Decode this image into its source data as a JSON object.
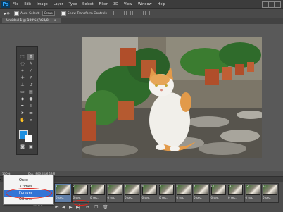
{
  "app": {
    "logo": "Ps"
  },
  "menubar": {
    "items": [
      "File",
      "Edit",
      "Image",
      "Layer",
      "Type",
      "Select",
      "Filter",
      "3D",
      "View",
      "Window",
      "Help"
    ]
  },
  "options": {
    "auto_select_label": "Auto-Select:",
    "auto_select_value": "Group",
    "transform_label": "Show Transform Controls"
  },
  "document": {
    "tab_title": "Untitled-1 @ 100% (RGB/8)"
  },
  "status": {
    "zoom": "100%",
    "doc_info": "Doc: 806.4K/6.13M"
  },
  "timeline": {
    "frames": [
      {
        "num": "1",
        "delay": "0 sec.",
        "selected": true
      },
      {
        "num": "2",
        "delay": "0 sec."
      },
      {
        "num": "3",
        "delay": "0 sec."
      },
      {
        "num": "4",
        "delay": "0 sec."
      },
      {
        "num": "5",
        "delay": "0 sec."
      },
      {
        "num": "6",
        "delay": "0 sec."
      },
      {
        "num": "7",
        "delay": "0 sec."
      },
      {
        "num": "8",
        "delay": "0 sec."
      },
      {
        "num": "9",
        "delay": "0 sec."
      },
      {
        "num": "10",
        "delay": "0 sec."
      },
      {
        "num": "11",
        "delay": "0 sec."
      },
      {
        "num": "12",
        "delay": "0 sec."
      },
      {
        "num": "13",
        "delay": "0 sec."
      }
    ],
    "loop_value": "Once"
  },
  "loop_menu": {
    "options": [
      {
        "label": "Once",
        "checked": true
      },
      {
        "label": "3 times"
      },
      {
        "label": "Forever",
        "highlighted": true
      },
      {
        "label": "Other..."
      }
    ]
  },
  "colors": {
    "highlight": "#3375d6",
    "annotation": "#e2231a",
    "swatch": "#1d8fe0"
  }
}
